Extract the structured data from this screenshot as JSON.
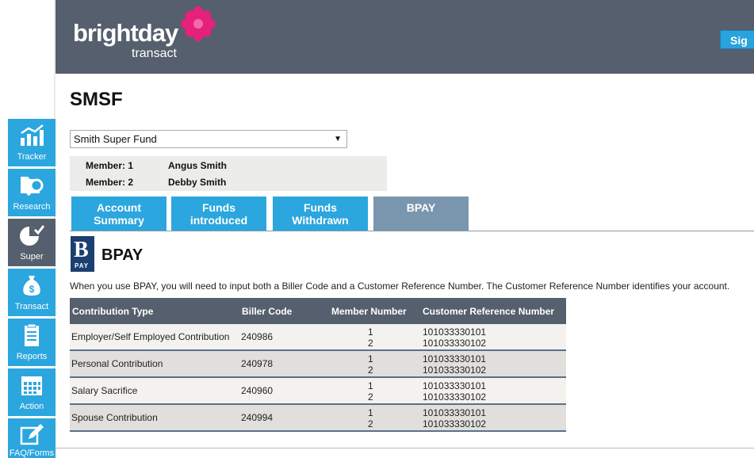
{
  "header": {
    "logo_main": "brightday",
    "logo_sub": "transact",
    "signin_label": "Sig"
  },
  "sidebar": {
    "items": [
      {
        "label": "Tracker",
        "icon": "chart-icon"
      },
      {
        "label": "Research",
        "icon": "folder-search-icon"
      },
      {
        "label": "Super",
        "icon": "pie-check-icon",
        "active": true
      },
      {
        "label": "Transact",
        "icon": "money-bag-icon"
      },
      {
        "label": "Reports",
        "icon": "clipboard-icon"
      },
      {
        "label": "Action",
        "icon": "calendar-icon"
      },
      {
        "label": "FAQ/Forms",
        "icon": "edit-icon"
      }
    ]
  },
  "page": {
    "title": "SMSF",
    "fund_select": {
      "value": "Smith Super Fund"
    },
    "members": [
      {
        "label": "Member: 1",
        "name": "Angus Smith"
      },
      {
        "label": "Member: 2",
        "name": "Debby Smith"
      }
    ],
    "tabs": [
      {
        "line1": "Account",
        "line2": "Summary"
      },
      {
        "line1": "Funds",
        "line2": "introduced"
      },
      {
        "line1": "Funds",
        "line2": "Withdrawn"
      },
      {
        "line1": "BPAY",
        "line2": "",
        "active": true
      }
    ]
  },
  "bpay": {
    "logo_letter": "B",
    "logo_pay": "PAY",
    "title": "BPAY",
    "description": "When you use BPAY, you will need to input both a Biller Code and a Customer Reference Number. The Customer Reference Number identifies your account.",
    "columns": [
      "Contribution Type",
      "Biller Code",
      "Member Number",
      "Customer Reference Number"
    ],
    "rows": [
      {
        "type": "Employer/Self Employed Contribution",
        "biller": "240986",
        "members": [
          "1",
          "2"
        ],
        "refs": [
          "101033330101",
          "101033330102"
        ]
      },
      {
        "type": "Personal Contribution",
        "biller": "240978",
        "members": [
          "1",
          "2"
        ],
        "refs": [
          "101033330101",
          "101033330102"
        ]
      },
      {
        "type": "Salary Sacrifice",
        "biller": "240960",
        "members": [
          "1",
          "2"
        ],
        "refs": [
          "101033330101",
          "101033330102"
        ]
      },
      {
        "type": "Spouse Contribution",
        "biller": "240994",
        "members": [
          "1",
          "2"
        ],
        "refs": [
          "101033330101",
          "101033330102"
        ]
      }
    ]
  },
  "colors": {
    "header_bg": "#555f6d",
    "accent_blue": "#2ba6de",
    "active_tab": "#7a96ae",
    "brand_pink": "#e5217c"
  }
}
